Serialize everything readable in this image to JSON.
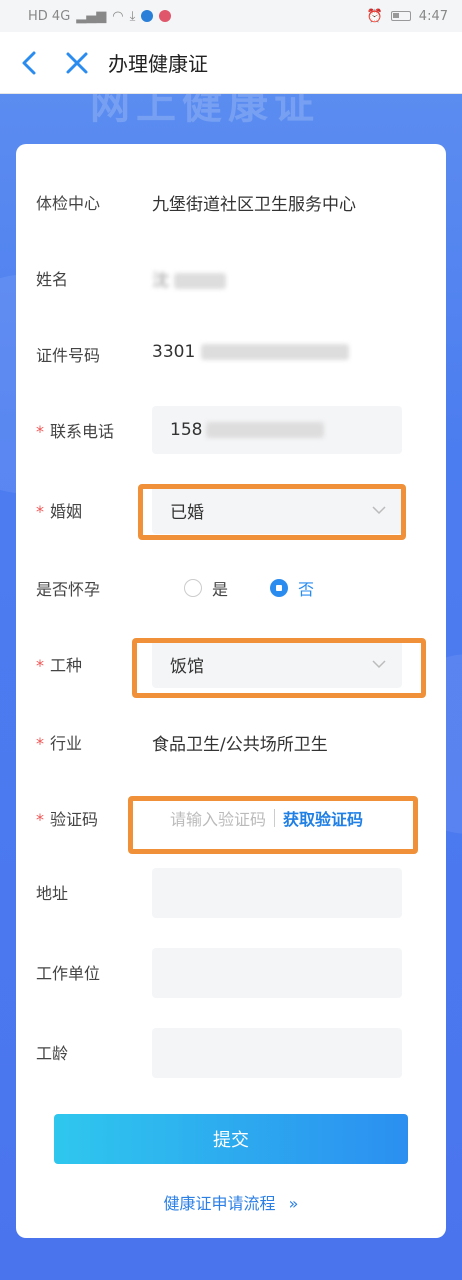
{
  "status_bar": {
    "time": "4:47",
    "network": "HD 4G"
  },
  "header": {
    "title": "办理健康证"
  },
  "banner": {
    "text": "网上健康证"
  },
  "form": {
    "exam_center": {
      "label": "体检中心",
      "value": "九堡街道社区卫生服务中心"
    },
    "name": {
      "label": "姓名",
      "value": "沈"
    },
    "id_number": {
      "label": "证件号码",
      "value": "3301"
    },
    "phone": {
      "label": "联系电话",
      "required": "*",
      "value": "158"
    },
    "marriage": {
      "label": "婚姻",
      "required": "*",
      "value": "已婚"
    },
    "pregnant": {
      "label": "是否怀孕",
      "option_yes": "是",
      "option_no": "否",
      "selected": "否"
    },
    "job_type": {
      "label": "工种",
      "required": "*",
      "value": "饭馆"
    },
    "industry": {
      "label": "行业",
      "required": "*",
      "value": "食品卫生/公共场所卫生"
    },
    "verify_code": {
      "label": "验证码",
      "required": "*",
      "placeholder": "请输入验证码",
      "button": "获取验证码"
    },
    "address": {
      "label": "地址",
      "value": ""
    },
    "work_unit": {
      "label": "工作单位",
      "value": ""
    },
    "work_years": {
      "label": "工龄",
      "value": ""
    }
  },
  "submit": {
    "label": "提交"
  },
  "process_link": {
    "label": "健康证申请流程",
    "icon": "double-chevron-right-icon"
  },
  "colors": {
    "accent": "#2b8cf0",
    "highlight": "#f0913a",
    "background": "#4c7df0"
  }
}
